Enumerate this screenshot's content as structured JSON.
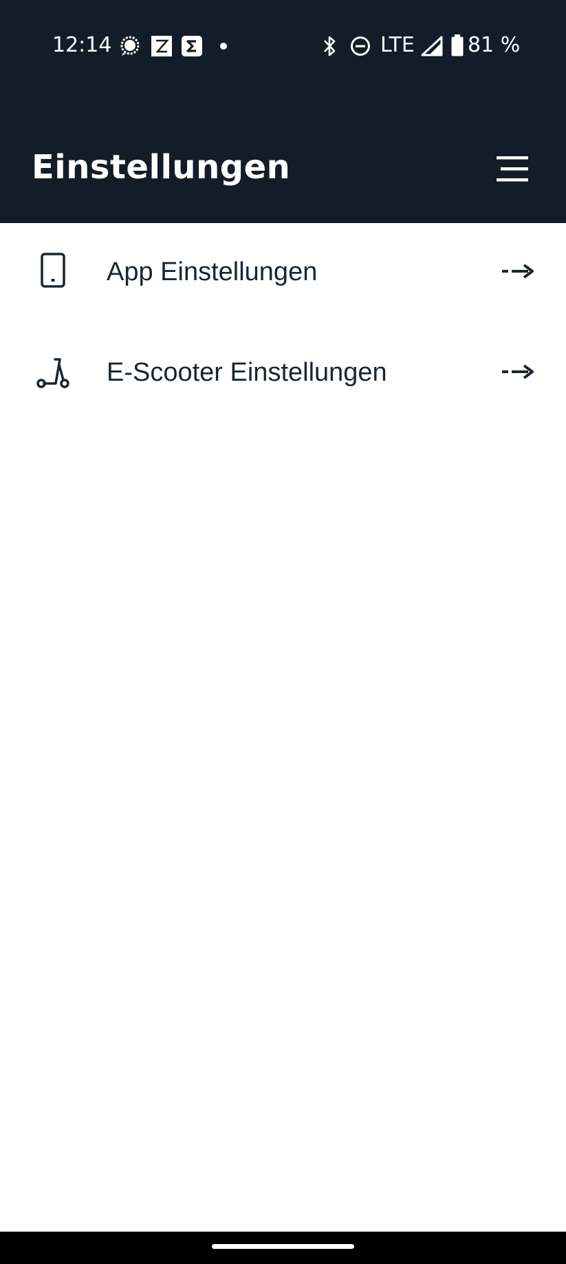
{
  "status_bar": {
    "time": "12:14",
    "network": "LTE",
    "battery": "81 %",
    "left_icons": [
      "chat-bubble-icon",
      "zapp-icon",
      "sigma-icon",
      "dot-icon"
    ],
    "right_icons": [
      "bluetooth-icon",
      "do-not-disturb-icon",
      "signal-icon",
      "battery-icon"
    ]
  },
  "header": {
    "title": "Einstellungen",
    "menu_icon": "hamburger-menu-icon",
    "background": "#121d29"
  },
  "settings": {
    "items": [
      {
        "label": "App Einstellungen",
        "icon": "smartphone-icon",
        "arrow_icon": "arrow-right-icon"
      },
      {
        "label": "E-Scooter Einstellungen",
        "icon": "scooter-icon",
        "arrow_icon": "arrow-right-icon"
      }
    ]
  },
  "colors": {
    "header_bg": "#121d29",
    "text_primary": "#1a2531",
    "page_bg": "#ffffff"
  }
}
